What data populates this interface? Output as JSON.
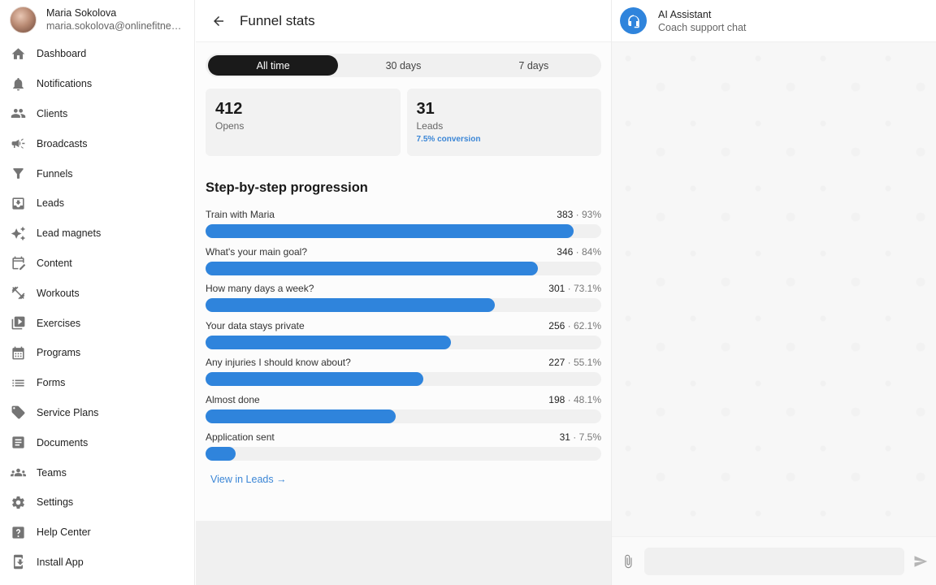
{
  "profile": {
    "name": "Maria Sokolova",
    "email": "maria.sokolova@onlinefitness.com"
  },
  "sidebar": {
    "items": [
      {
        "label": "Dashboard",
        "icon": "home-icon"
      },
      {
        "label": "Notifications",
        "icon": "bell-icon"
      },
      {
        "label": "Clients",
        "icon": "people-icon"
      },
      {
        "label": "Broadcasts",
        "icon": "megaphone-icon"
      },
      {
        "label": "Funnels",
        "icon": "funnel-icon"
      },
      {
        "label": "Leads",
        "icon": "inbox-download-icon"
      },
      {
        "label": "Lead magnets",
        "icon": "sparkle-icon"
      },
      {
        "label": "Content",
        "icon": "calendar-edit-icon"
      },
      {
        "label": "Workouts",
        "icon": "dumbbell-icon"
      },
      {
        "label": "Exercises",
        "icon": "video-library-icon"
      },
      {
        "label": "Programs",
        "icon": "calendar-icon"
      },
      {
        "label": "Forms",
        "icon": "list-icon"
      },
      {
        "label": "Service Plans",
        "icon": "tag-icon"
      },
      {
        "label": "Documents",
        "icon": "document-icon"
      },
      {
        "label": "Teams",
        "icon": "group-icon"
      },
      {
        "label": "Settings",
        "icon": "gear-icon"
      },
      {
        "label": "Help Center",
        "icon": "help-icon"
      },
      {
        "label": "Install App",
        "icon": "install-icon"
      }
    ]
  },
  "main": {
    "title": "Funnel stats",
    "ranges": [
      "All time",
      "30 days",
      "7 days"
    ],
    "active_range": "All time",
    "cards": {
      "opens": {
        "value": "412",
        "label": "Opens"
      },
      "leads": {
        "value": "31",
        "label": "Leads",
        "sub": "7.5% conversion"
      }
    },
    "section_title": "Step-by-step progression",
    "steps": [
      {
        "name": "Train with Maria",
        "count": "383",
        "pct": "93%",
        "fill": 0.93
      },
      {
        "name": "What's your main goal?",
        "count": "346",
        "pct": "84%",
        "fill": 0.84
      },
      {
        "name": "How many days a week?",
        "count": "301",
        "pct": "73.1%",
        "fill": 0.731
      },
      {
        "name": "Your data stays private",
        "count": "256",
        "pct": "62.1%",
        "fill": 0.621
      },
      {
        "name": "Any injuries I should know about?",
        "count": "227",
        "pct": "55.1%",
        "fill": 0.551
      },
      {
        "name": "Almost done",
        "count": "198",
        "pct": "48.1%",
        "fill": 0.481
      },
      {
        "name": "Application sent",
        "count": "31",
        "pct": "7.5%",
        "fill": 0.075
      }
    ],
    "view_link": "View in Leads →"
  },
  "chat": {
    "title": "AI Assistant",
    "subtitle": "Coach support chat",
    "input_placeholder": ""
  },
  "colors": {
    "accent": "#2f84dc",
    "active_toggle": "#1a1a1a"
  }
}
